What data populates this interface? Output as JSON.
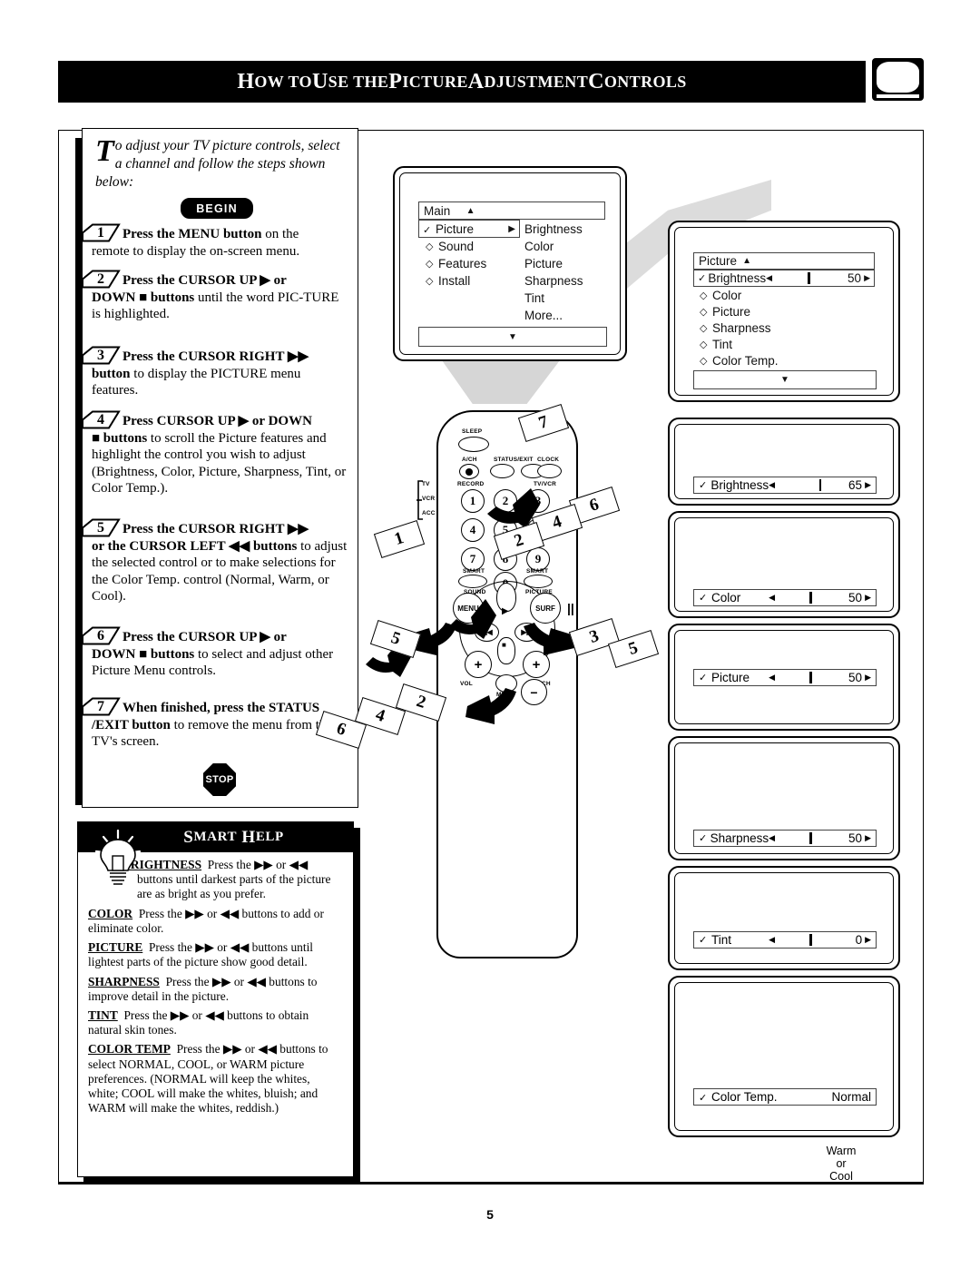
{
  "header": {
    "title": "How to Use the Picture Adjustment Controls",
    "tv_icon": "tv-icon"
  },
  "page": {
    "number": "5"
  },
  "intro": {
    "dropcap": "T",
    "text": "o adjust your TV picture controls, select a channel and follow the steps shown below:"
  },
  "begin_badge": "BEGIN",
  "stop_badge": "STOP",
  "steps": [
    {
      "num": "1",
      "line1_bold": "Press the MENU button",
      "line1_rest": " on the",
      "rest": "remote to display the on-screen menu."
    },
    {
      "num": "2",
      "line1_bold": "Press the CURSOR UP",
      "line1_rest": " ▶ or",
      "rest_bold": "DOWN ■ buttons",
      "rest": " until the word PIC-TURE is highlighted."
    },
    {
      "num": "3",
      "line1_bold": "Press the CURSOR RIGHT",
      "line1_rest": " ▶▶",
      "rest_bold": "button",
      "rest": " to display the PICTURE menu features."
    },
    {
      "num": "4",
      "line1_bold": "Press CURSOR UP",
      "line1_rest": " ▶ or DOWN",
      "rest_bold": "■ buttons",
      "rest": " to scroll the Picture features and highlight the control you wish to adjust (Brightness, Color, Picture, Sharpness, Tint, or Color Temp.)."
    },
    {
      "num": "5",
      "line1_bold": "Press the CURSOR RIGHT",
      "line1_rest": " ▶▶",
      "rest_bold": "or the CURSOR LEFT ◀◀ buttons",
      "rest": " to adjust the selected control or to make selections for the Color Temp. control (Normal, Warm, or Cool)."
    },
    {
      "num": "6",
      "line1_bold": "Press the CURSOR UP",
      "line1_rest": " ▶ or",
      "rest_bold": "DOWN ■ buttons",
      "rest": " to select and adjust other Picture Menu controls."
    },
    {
      "num": "7",
      "line1_bold": "When finished, press the STATUS",
      "line1_rest": "",
      "rest_bold": "/EXIT button",
      "rest": " to remove the menu from the TV's screen."
    }
  ],
  "smart_help": {
    "title": "Smart Help",
    "icon": "lightbulb-icon",
    "entries": [
      {
        "term": "BRIGHTNESS",
        "text": "Press the ▶▶ or ◀◀ buttons until darkest parts of the picture are as bright as you prefer."
      },
      {
        "term": "COLOR",
        "text": "Press the ▶▶ or ◀◀ buttons to add or eliminate color."
      },
      {
        "term": "PICTURE",
        "text": "Press the ▶▶ or ◀◀ buttons until lightest parts of the picture show good detail."
      },
      {
        "term": "SHARPNESS",
        "text": "Press the ▶▶ or ◀◀ buttons to improve detail in the picture."
      },
      {
        "term": "TINT",
        "text": "Press the ▶▶ or ◀◀ buttons to obtain natural skin tones."
      },
      {
        "term": "COLOR TEMP",
        "text": "Press the ▶▶ or ◀◀ buttons to select NORMAL, COOL, or WARM picture preferences. (NORMAL will keep the whites, white; COOL will make the whites, bluish; and WARM will make the whites, reddish.)"
      }
    ]
  },
  "main_menu": {
    "header_label": "Main",
    "header_arrow": "▲",
    "selected": {
      "check": "✓",
      "label": "Picture",
      "arrow": "▶"
    },
    "items": [
      {
        "bullet": "◇",
        "label": "Sound"
      },
      {
        "bullet": "◇",
        "label": "Features"
      },
      {
        "bullet": "◇",
        "label": "Install"
      }
    ],
    "submenu": [
      "Brightness",
      "Color",
      "Picture",
      "Sharpness",
      "Tint",
      "More..."
    ],
    "footer_arrow": "▼"
  },
  "picture_menu": {
    "header_label": "Picture",
    "header_arrow": "▲",
    "selected": {
      "check": "✓",
      "label": "Brightness",
      "left": "◀",
      "right": "▶",
      "value": "50"
    },
    "items": [
      {
        "bullet": "◇",
        "label": "Color"
      },
      {
        "bullet": "◇",
        "label": "Picture"
      },
      {
        "bullet": "◇",
        "label": "Sharpness"
      },
      {
        "bullet": "◇",
        "label": "Tint"
      },
      {
        "bullet": "◇",
        "label": "Color Temp."
      }
    ],
    "footer_arrow": "▼"
  },
  "adjust_panels": [
    {
      "check": "✓",
      "label": "Brightness",
      "left": "◀",
      "right": "▶",
      "value": "65",
      "knob_pct": 65
    },
    {
      "check": "✓",
      "label": "Color",
      "left": "◀",
      "right": "▶",
      "value": "50",
      "knob_pct": 50
    },
    {
      "check": "✓",
      "label": "Picture",
      "left": "◀",
      "right": "▶",
      "value": "50",
      "knob_pct": 50
    },
    {
      "check": "✓",
      "label": "Sharpness",
      "left": "◀",
      "right": "▶",
      "value": "50",
      "knob_pct": 50
    },
    {
      "check": "✓",
      "label": "Tint",
      "left": "◀",
      "right": "▶",
      "value": "0",
      "knob_pct": 50
    }
  ],
  "color_temp_panel": {
    "check": "✓",
    "label": "Color Temp.",
    "value": "Normal"
  },
  "color_temp_note": "Warm\nor\nCool",
  "remote": {
    "labels": {
      "sleep": "SLEEP",
      "ach": "A/CH",
      "status_exit": "STATUS/EXIT",
      "clock": "CLOCK",
      "record": "RECORD",
      "tvvcr": "TV/VCR",
      "tv": "TV",
      "vcr": "VCR",
      "acc": "ACC",
      "smart_left": "SMART",
      "smart_right": "SMART",
      "sound": "SOUND",
      "picture": "PICTURE",
      "menu": "MENU",
      "surf": "SURF",
      "vol": "VOL",
      "ch": "CH",
      "mute": "MUTE"
    },
    "keypad": [
      "1",
      "2",
      "3",
      "4",
      "5",
      "6",
      "7",
      "8",
      "9",
      "0"
    ],
    "step_flags": [
      "1",
      "2",
      "3",
      "4",
      "5",
      "6",
      "7"
    ]
  }
}
